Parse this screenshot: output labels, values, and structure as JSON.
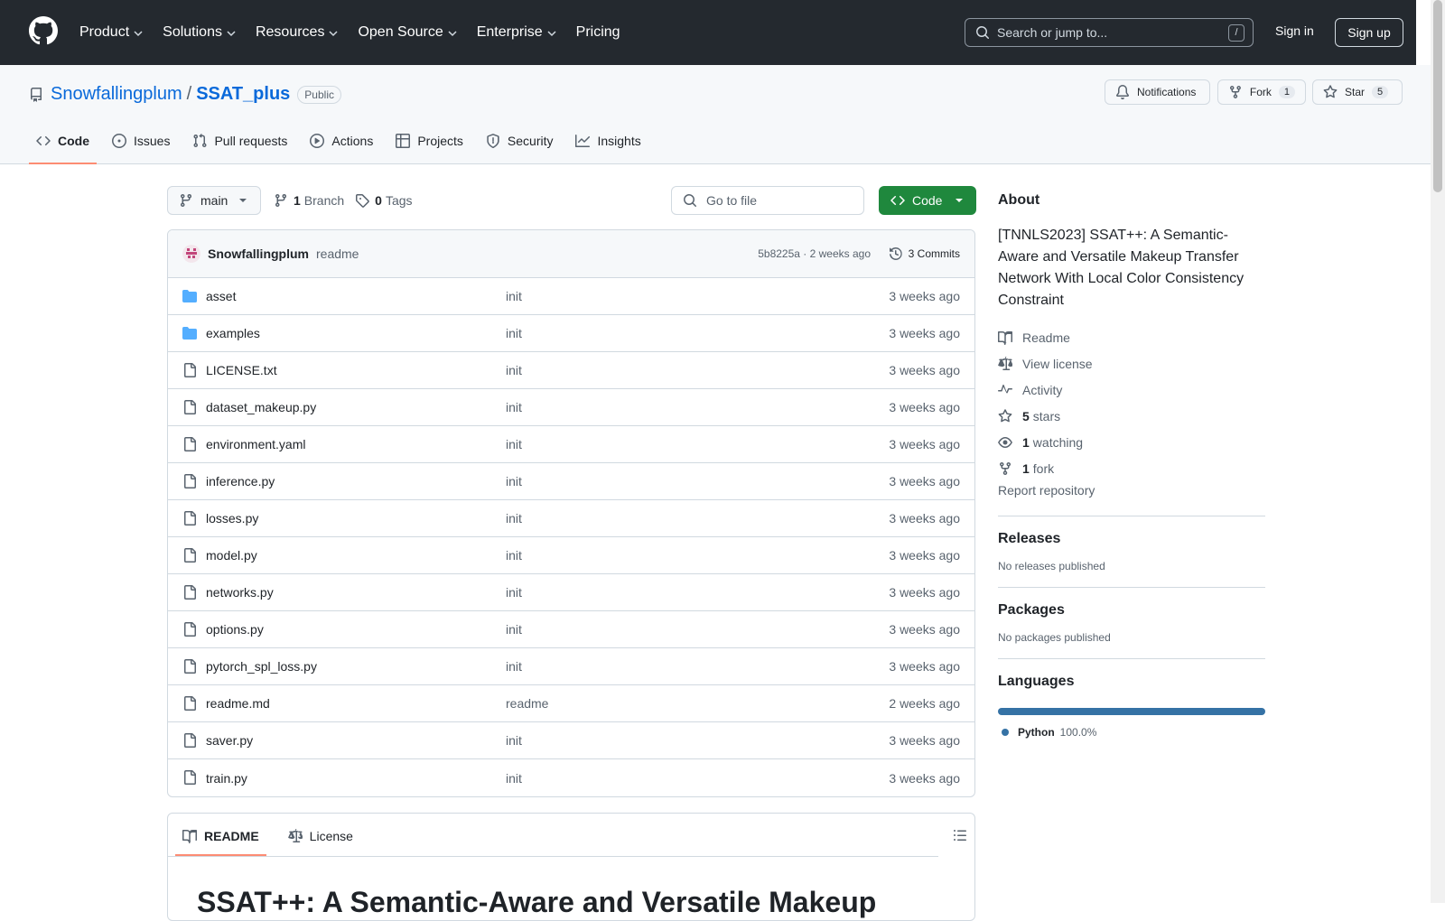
{
  "topnav": {
    "items": [
      {
        "label": "Product",
        "dropdown": true
      },
      {
        "label": "Solutions",
        "dropdown": true
      },
      {
        "label": "Resources",
        "dropdown": true
      },
      {
        "label": "Open Source",
        "dropdown": true
      },
      {
        "label": "Enterprise",
        "dropdown": true
      },
      {
        "label": "Pricing",
        "dropdown": false
      }
    ],
    "search_placeholder": "Search or jump to...",
    "search_shortcut": "/",
    "signin": "Sign in",
    "signup": "Sign up"
  },
  "repo": {
    "owner": "Snowfallingplum",
    "separator": "/",
    "name": "SSAT_plus",
    "visibility": "Public",
    "notifications_label": "Notifications",
    "fork_label": "Fork",
    "fork_count": "1",
    "star_label": "Star",
    "star_count": "5"
  },
  "tabs": [
    {
      "label": "Code",
      "icon": "code-icon",
      "active": true
    },
    {
      "label": "Issues",
      "icon": "issue-icon"
    },
    {
      "label": "Pull requests",
      "icon": "pull-request-icon"
    },
    {
      "label": "Actions",
      "icon": "play-icon"
    },
    {
      "label": "Projects",
      "icon": "table-icon"
    },
    {
      "label": "Security",
      "icon": "shield-icon"
    },
    {
      "label": "Insights",
      "icon": "graph-icon"
    }
  ],
  "toolbar": {
    "branch": "main",
    "branch_count": "1",
    "branch_label": "Branch",
    "tag_count": "0",
    "tag_label": "Tags",
    "goto_placeholder": "Go to file",
    "code_label": "Code"
  },
  "commit": {
    "author": "Snowfallingplum",
    "message": "readme",
    "meta": "5b8225a · 2 weeks ago",
    "commits_label": "3 Commits"
  },
  "files": [
    {
      "name": "asset",
      "type": "folder",
      "message": "init",
      "date": "3 weeks ago"
    },
    {
      "name": "examples",
      "type": "folder",
      "message": "init",
      "date": "3 weeks ago"
    },
    {
      "name": "LICENSE.txt",
      "type": "file",
      "message": "init",
      "date": "3 weeks ago"
    },
    {
      "name": "dataset_makeup.py",
      "type": "file",
      "message": "init",
      "date": "3 weeks ago"
    },
    {
      "name": "environment.yaml",
      "type": "file",
      "message": "init",
      "date": "3 weeks ago"
    },
    {
      "name": "inference.py",
      "type": "file",
      "message": "init",
      "date": "3 weeks ago"
    },
    {
      "name": "losses.py",
      "type": "file",
      "message": "init",
      "date": "3 weeks ago"
    },
    {
      "name": "model.py",
      "type": "file",
      "message": "init",
      "date": "3 weeks ago"
    },
    {
      "name": "networks.py",
      "type": "file",
      "message": "init",
      "date": "3 weeks ago"
    },
    {
      "name": "options.py",
      "type": "file",
      "message": "init",
      "date": "3 weeks ago"
    },
    {
      "name": "pytorch_spl_loss.py",
      "type": "file",
      "message": "init",
      "date": "3 weeks ago"
    },
    {
      "name": "readme.md",
      "type": "file",
      "message": "readme",
      "date": "2 weeks ago"
    },
    {
      "name": "saver.py",
      "type": "file",
      "message": "init",
      "date": "3 weeks ago"
    },
    {
      "name": "train.py",
      "type": "file",
      "message": "init",
      "date": "3 weeks ago"
    }
  ],
  "readme": {
    "tab_readme": "README",
    "tab_license": "License",
    "title": "SSAT++: A Semantic-Aware and Versatile Makeup"
  },
  "about": {
    "heading": "About",
    "description": "[TNNLS2023] SSAT++: A Semantic-Aware and Versatile Makeup Transfer Network With Local Color Consistency Constraint",
    "links": [
      {
        "icon": "book-icon",
        "count": "",
        "label": "Readme"
      },
      {
        "icon": "law-icon",
        "count": "",
        "label": "View license"
      },
      {
        "icon": "pulse-icon",
        "count": "",
        "label": "Activity"
      },
      {
        "icon": "star-icon",
        "count": "5",
        "label": "stars"
      },
      {
        "icon": "eye-icon",
        "count": "1",
        "label": "watching"
      },
      {
        "icon": "fork-icon",
        "count": "1",
        "label": "fork"
      }
    ],
    "report": "Report repository"
  },
  "releases": {
    "heading": "Releases",
    "text": "No releases published"
  },
  "packages": {
    "heading": "Packages",
    "text": "No packages published"
  },
  "languages": {
    "heading": "Languages",
    "items": [
      {
        "name": "Python",
        "percent": "100.0%",
        "color": "#3572a5"
      }
    ]
  },
  "colors": {
    "topbar": "#24292f",
    "accent": "#0969da",
    "code_button": "#1f883d",
    "tab_underline": "#fd8c73"
  }
}
